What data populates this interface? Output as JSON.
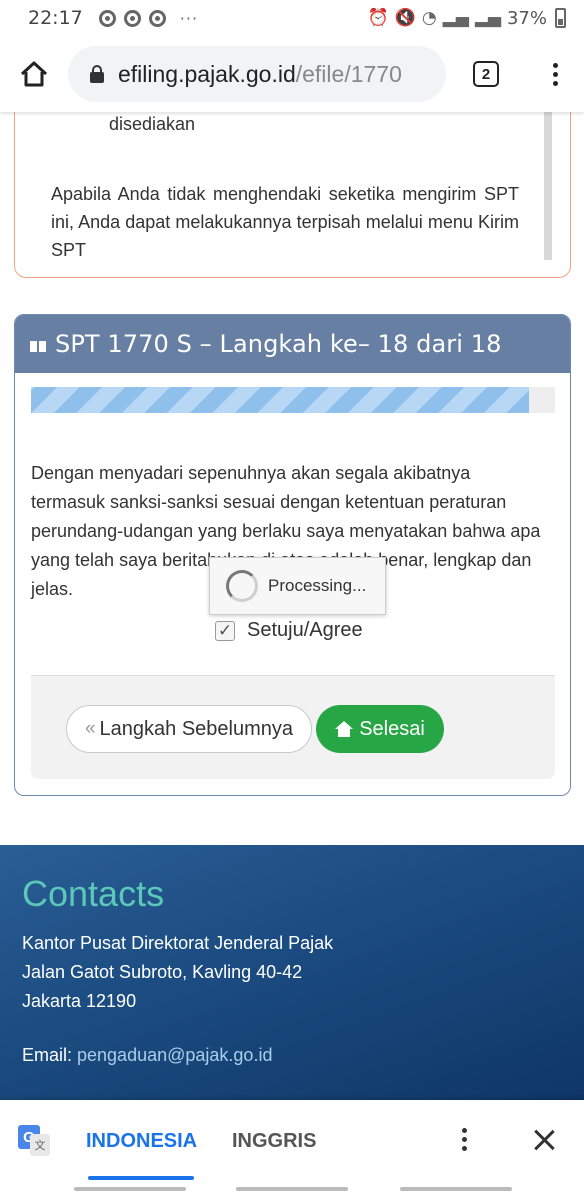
{
  "status_bar": {
    "time": "22:17",
    "more": "···",
    "battery": "37%"
  },
  "browser": {
    "url_host": "efiling.pajak.go.id",
    "url_path": "/efile/1770",
    "tab_count": "2"
  },
  "notice": {
    "line1": "disediakan",
    "paragraph": "Apabila Anda tidak menghendaki seketika mengirim SPT ini, Anda dapat melakukannya terpisah melalui menu Kirim SPT"
  },
  "spt": {
    "title": "SPT 1770 S – Langkah ke– 18 dari 18",
    "progress_fraction": 0.95,
    "declaration": "Dengan menyadari sepenuhnya akan segala akibatnya termasuk sanksi-sanksi sesuai dengan ketentuan peraturan perundang-udangan yang berlaku saya menyatakan bahwa apa yang telah saya beritahukan di atas adalah benar, lengkap dan jelas.",
    "agree_label": "Setuju/Agree",
    "agree_checked": true,
    "prev_label": "Langkah Sebelumnya",
    "done_label": "Selesai",
    "done_color": "#27a645"
  },
  "processing": {
    "text": "Processing..."
  },
  "contacts": {
    "title": "Contacts",
    "address": [
      "Kantor Pusat Direktorat Jenderal Pajak",
      "Jalan Gatot Subroto, Kavling 40-42",
      "Jakarta 12190"
    ],
    "email_label": "Email: ",
    "email": "pengaduan@pajak.go.id"
  },
  "translate_bar": {
    "tab_active": "INDONESIA",
    "tab_inactive": "INGGRIS",
    "accent": "#1a73e8"
  }
}
